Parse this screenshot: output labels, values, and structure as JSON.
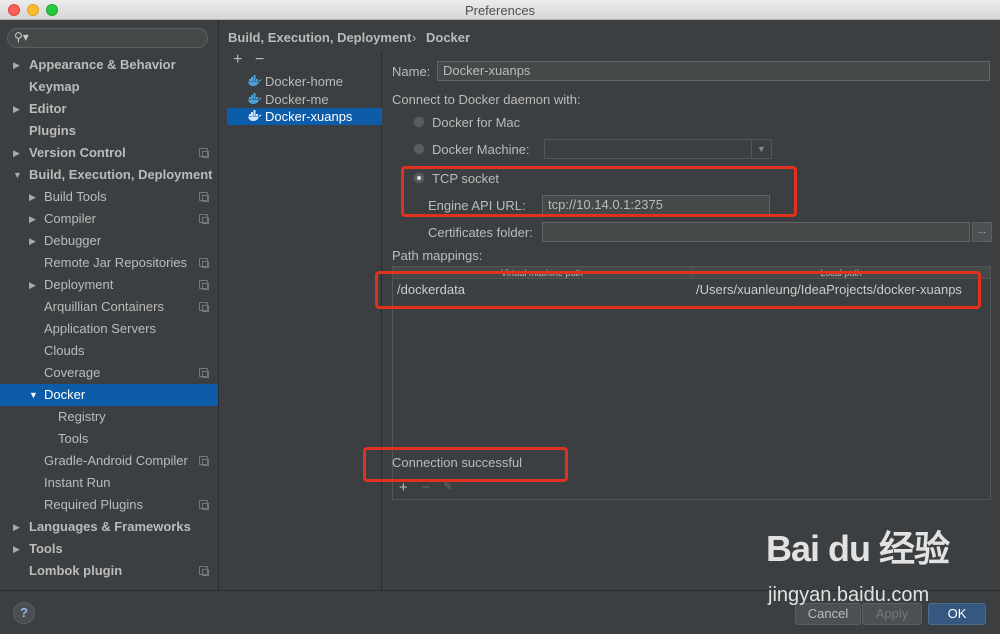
{
  "window": {
    "title": "Preferences"
  },
  "search": {
    "placeholder": ""
  },
  "sidebar": {
    "items": [
      {
        "label": "Appearance & Behavior",
        "bold": true,
        "arrow": "▶",
        "level": 0,
        "copy": false
      },
      {
        "label": "Keymap",
        "bold": true,
        "arrow": "",
        "level": 0,
        "copy": false
      },
      {
        "label": "Editor",
        "bold": true,
        "arrow": "▶",
        "level": 0,
        "copy": false
      },
      {
        "label": "Plugins",
        "bold": true,
        "arrow": "",
        "level": 0,
        "copy": false
      },
      {
        "label": "Version Control",
        "bold": true,
        "arrow": "▶",
        "level": 0,
        "copy": true
      },
      {
        "label": "Build, Execution, Deployment",
        "bold": true,
        "arrow": "▼",
        "level": 0,
        "copy": false
      },
      {
        "label": "Build Tools",
        "bold": false,
        "arrow": "▶",
        "level": 1,
        "copy": true
      },
      {
        "label": "Compiler",
        "bold": false,
        "arrow": "▶",
        "level": 1,
        "copy": true
      },
      {
        "label": "Debugger",
        "bold": false,
        "arrow": "▶",
        "level": 1,
        "copy": false
      },
      {
        "label": "Remote Jar Repositories",
        "bold": false,
        "arrow": "",
        "level": 1,
        "copy": true
      },
      {
        "label": "Deployment",
        "bold": false,
        "arrow": "▶",
        "level": 1,
        "copy": true
      },
      {
        "label": "Arquillian Containers",
        "bold": false,
        "arrow": "",
        "level": 1,
        "copy": true
      },
      {
        "label": "Application Servers",
        "bold": false,
        "arrow": "",
        "level": 1,
        "copy": false
      },
      {
        "label": "Clouds",
        "bold": false,
        "arrow": "",
        "level": 1,
        "copy": false
      },
      {
        "label": "Coverage",
        "bold": false,
        "arrow": "",
        "level": 1,
        "copy": true
      },
      {
        "label": "Docker",
        "bold": false,
        "arrow": "▼",
        "level": 1,
        "copy": false,
        "selected": true
      },
      {
        "label": "Registry",
        "bold": false,
        "arrow": "",
        "level": 2,
        "copy": false
      },
      {
        "label": "Tools",
        "bold": false,
        "arrow": "",
        "level": 2,
        "copy": false
      },
      {
        "label": "Gradle-Android Compiler",
        "bold": false,
        "arrow": "",
        "level": 1,
        "copy": true
      },
      {
        "label": "Instant Run",
        "bold": false,
        "arrow": "",
        "level": 1,
        "copy": false
      },
      {
        "label": "Required Plugins",
        "bold": false,
        "arrow": "",
        "level": 1,
        "copy": true
      },
      {
        "label": "Languages & Frameworks",
        "bold": true,
        "arrow": "▶",
        "level": 0,
        "copy": false
      },
      {
        "label": "Tools",
        "bold": true,
        "arrow": "▶",
        "level": 0,
        "copy": false
      },
      {
        "label": "Lombok plugin",
        "bold": true,
        "arrow": "",
        "level": 0,
        "copy": true
      }
    ]
  },
  "breadcrumb": {
    "parent": "Build, Execution, Deployment",
    "separator": "›",
    "current": "Docker"
  },
  "docker_list": {
    "add_label": "+",
    "remove_label": "−",
    "items": [
      {
        "label": "Docker-home",
        "selected": false
      },
      {
        "label": "Docker-me",
        "selected": false
      },
      {
        "label": "Docker-xuanps",
        "selected": true
      }
    ]
  },
  "form": {
    "name_label": "Name:",
    "name_value": "Docker-xuanps",
    "connect_label": "Connect to Docker daemon with:",
    "radio_mac": "Docker for Mac",
    "radio_machine": "Docker Machine:",
    "radio_tcp": "TCP socket",
    "selected_connection": "TCP socket",
    "engine_url_label": "Engine API URL:",
    "engine_url_value": "tcp://10.14.0.1:2375",
    "certs_label": "Certificates folder:",
    "certs_value": "",
    "browse_label": "...",
    "path_mappings_label": "Path mappings:",
    "table": {
      "columns": [
        "Virtual machine path",
        "Local path"
      ],
      "rows": [
        [
          "/dockerdata",
          "/Users/xuanleung/IdeaProjects/docker-xuanps"
        ]
      ]
    },
    "table_add": "+",
    "table_remove": "−",
    "table_edit": "✎",
    "status": "Connection successful"
  },
  "footer": {
    "help_label": "?",
    "cancel_label": "Cancel",
    "apply_label": "Apply",
    "ok_label": "OK"
  },
  "watermark": {
    "logo": "Bai du 经验",
    "url": "jingyan.baidu.com"
  },
  "colors": {
    "selection": "#0d5ca9",
    "highlight_box": "#e0301e",
    "ok_button": "#365880"
  }
}
